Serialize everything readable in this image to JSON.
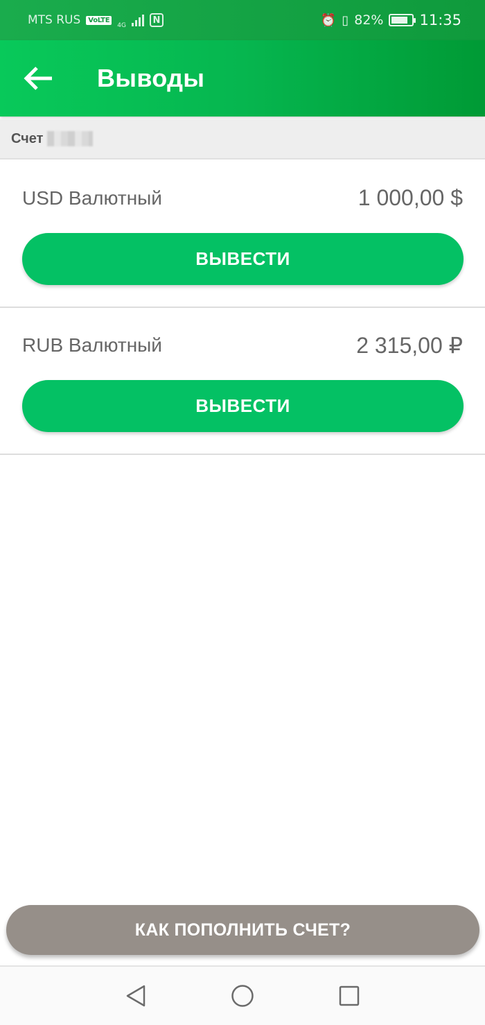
{
  "status_bar": {
    "carrier": "MTS RUS",
    "volte": "VoLTE",
    "network_type": "4G",
    "nfc": "N",
    "battery_percent": "82%",
    "battery_level": 0.82,
    "time": "11:35"
  },
  "app_bar": {
    "title": "Выводы",
    "back_icon": "arrow-left-icon"
  },
  "account": {
    "label": "Счет"
  },
  "wallets": [
    {
      "name": "USD Валютный",
      "amount": "1 000,00 $",
      "button_label": "ВЫВЕСТИ"
    },
    {
      "name": "RUB Валютный",
      "amount": "2 315,00 ₽",
      "button_label": "ВЫВЕСТИ"
    }
  ],
  "topup_button": {
    "label": "КАК ПОПОЛНИТЬ СЧЕТ?"
  },
  "navigation": {
    "back": "triangle-back-icon",
    "home": "circle-home-icon",
    "recents": "square-recents-icon"
  },
  "colors": {
    "app_bar_green": "#06b64f",
    "button_green": "#04c164",
    "topup_gray": "#968f89"
  }
}
